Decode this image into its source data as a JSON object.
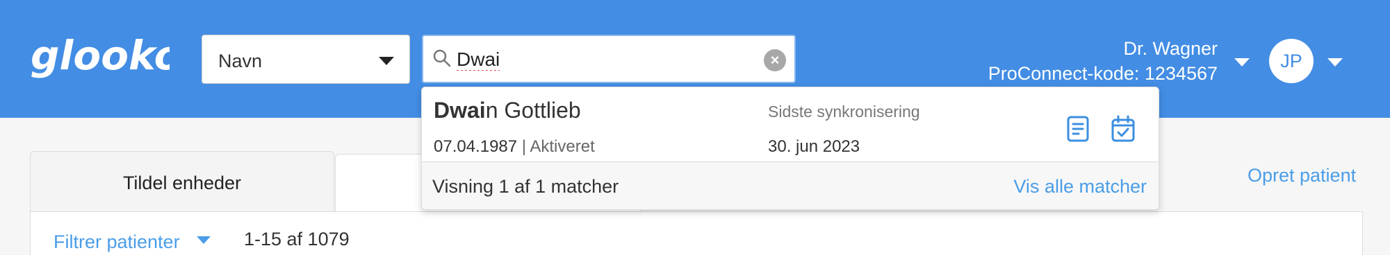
{
  "header": {
    "logo_text": "glooko",
    "search_type": {
      "selected": "Navn"
    },
    "search": {
      "value": "Dwai"
    },
    "user": {
      "name": "Dr. Wagner",
      "proconnect": "ProConnect-kode: 1234567",
      "initials": "JP"
    }
  },
  "tabs": [
    {
      "label": "Tildel enheder"
    },
    {
      "label": ""
    }
  ],
  "actions": {
    "create_patient": "Opret patient"
  },
  "filter": {
    "label": "Filtrer patienter",
    "count": "1-15 af 1079"
  },
  "search_results": {
    "items": [
      {
        "name_match": "Dwai",
        "name_rest": "n Gottlieb",
        "dob": "07.04.1987",
        "separator": " | ",
        "status": "Aktiveret",
        "sync_label": "Sidste synkronisering",
        "sync_date": "30. jun 2023",
        "icons": [
          "report-icon",
          "calendar-check-icon"
        ]
      }
    ],
    "summary": "Visning 1 af 1 matcher",
    "view_all": "Vis alle matcher"
  },
  "colors": {
    "header_bg": "#438de4",
    "link": "#4a9de8",
    "page_bg": "#f6f6f6"
  }
}
